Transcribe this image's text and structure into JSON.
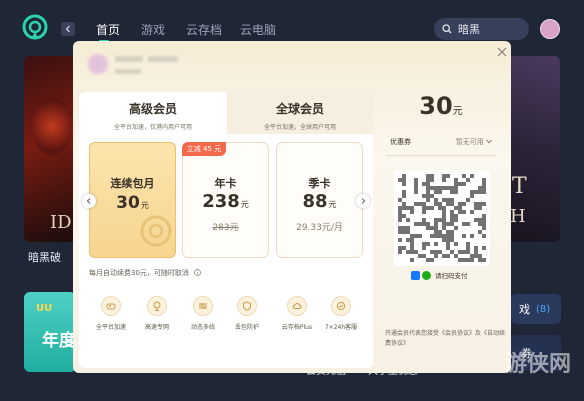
{
  "nav": {
    "items": [
      {
        "label": "首页",
        "active": true
      },
      {
        "label": "游戏"
      },
      {
        "label": "云存档"
      },
      {
        "label": "云电脑"
      }
    ],
    "search_value": "暗黑"
  },
  "background": {
    "game_title_left": "暗黑破",
    "game_title_right": "ID",
    "promo_text": "年度",
    "badge_text": "UU",
    "button_1": "戏",
    "button_1_count": "(8)",
    "button_2": "券",
    "bottom_links": [
      "会员充值",
      "大学生优惠"
    ]
  },
  "modal": {
    "tabs": [
      {
        "label": "高级会员",
        "sub": "全平台加速，仅港内用户可用"
      },
      {
        "label": "全球会员",
        "sub": "全平台加速，全球用户可用"
      }
    ],
    "plans": [
      {
        "name": "连续包月",
        "price": "30",
        "unit": "元",
        "note": "",
        "selected": true
      },
      {
        "name": "年卡",
        "price": "238",
        "unit": "元",
        "note": "283元",
        "badge": "立减 45 元"
      },
      {
        "name": "季卡",
        "price": "88",
        "unit": "元",
        "note": "29.33元/月"
      }
    ],
    "renew_text": "每月自动续费30元，可随时取消",
    "perks": [
      "全平台加速",
      "高速专网",
      "动态多线",
      "丢包防护",
      "云存档Plus",
      "7×24h客服"
    ],
    "total_price": "30",
    "total_unit": "元",
    "coupon_label": "优惠券",
    "coupon_value": "暂无可用",
    "pay_text": "请扫码支付",
    "terms": "开通会员代表您接受《会员协议》及《自动续费协议》"
  },
  "watermark": "游侠网",
  "colors": {
    "accent": "#2bd4a8",
    "gold": "#f2c46a",
    "badge": "#f26a4a"
  }
}
